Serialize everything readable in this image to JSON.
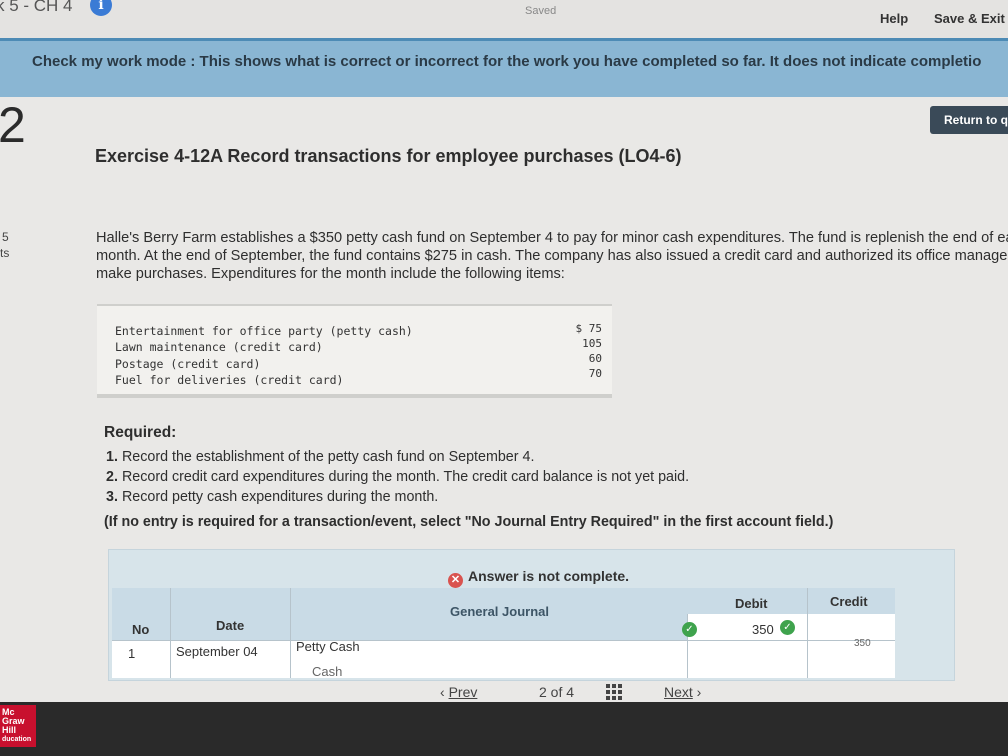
{
  "header": {
    "breadcrumb": "k 5 - CH 4",
    "saved_status": "Saved",
    "help_label": "Help",
    "save_exit_label": "Save & Exit"
  },
  "banner": {
    "text": "Check my work mode : This shows what is correct or incorrect for the work you have completed so far. It does not indicate completio"
  },
  "sidebar": {
    "question_number": "2",
    "points_value": "5",
    "points_label": "ts"
  },
  "return_button_label": "Return to q",
  "exercise": {
    "title": "Exercise 4-12A Record transactions for employee purchases (LO4-6)",
    "paragraph": "Halle's Berry Farm establishes a $350 petty cash fund on September 4 to pay for minor cash expenditures. The fund is replenish the end of each month. At the end of September, the fund contains $275 in cash. The company has also issued a credit card and authorized its office manager to make purchases. Expenditures for the month include the following items:",
    "expenditures": [
      {
        "item": "Entertainment for office party (petty cash)",
        "amount": "$ 75"
      },
      {
        "item": "Lawn maintenance (credit card)",
        "amount": "105"
      },
      {
        "item": "Postage (credit card)",
        "amount": "60"
      },
      {
        "item": "Fuel for deliveries (credit card)",
        "amount": "70"
      }
    ],
    "required_label": "Required:",
    "requirements": [
      {
        "num": "1.",
        "text": "Record the establishment of the petty cash fund on September 4."
      },
      {
        "num": "2.",
        "text": "Record credit card expenditures during the month. The credit card balance is not yet paid."
      },
      {
        "num": "3.",
        "text": "Record petty cash expenditures during the month."
      }
    ],
    "note": "(If no entry is required for a transaction/event, select \"No Journal Entry Required\" in the first account field.)"
  },
  "answer": {
    "status": "Answer is not complete.",
    "journal": {
      "title": "General Journal",
      "headers": {
        "no": "No",
        "date": "Date",
        "debit": "Debit",
        "credit": "Credit"
      },
      "rows": [
        {
          "no": "1",
          "date": "September 04",
          "account": "Petty Cash",
          "debit": "350",
          "credit": ""
        },
        {
          "no": "",
          "date": "",
          "account": "Cash",
          "debit": "",
          "credit": "350"
        }
      ]
    }
  },
  "pagination": {
    "prev_label": "Prev",
    "page_text": "2 of 4",
    "next_label": "Next"
  },
  "logo_text": [
    "Mc",
    "Graw",
    "Hill",
    "ducation"
  ],
  "colors": {
    "banner": "#8ab6d3",
    "return_button": "#3a4a58",
    "check": "#3fa34d",
    "error": "#d9534f"
  }
}
